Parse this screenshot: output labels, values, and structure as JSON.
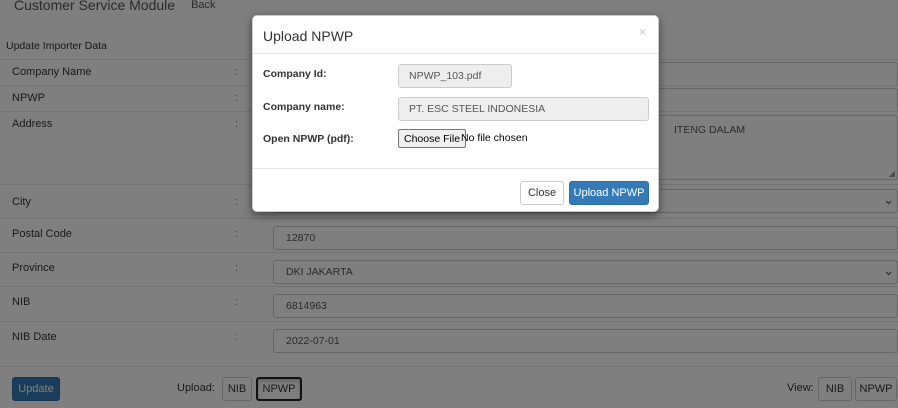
{
  "header": {
    "module_title": "Customer Service Module",
    "back_label": "Back"
  },
  "form": {
    "section_title": "Update Importer Data",
    "colon": ":",
    "rows": [
      {
        "label": "Company Name",
        "value": ""
      },
      {
        "label": "NPWP",
        "value": ""
      },
      {
        "label": "Address",
        "value": "ITENG DALAM"
      },
      {
        "label": "City",
        "value": ""
      },
      {
        "label": "Postal Code",
        "value": "12870"
      },
      {
        "label": "Province",
        "value": "DKI JAKARTA"
      },
      {
        "label": "NIB",
        "value": "6814963"
      },
      {
        "label": "NIB Date",
        "value": "2022-07-01"
      }
    ]
  },
  "footer": {
    "update_label": "Update",
    "upload_label": "Upload:",
    "upload_nib": "NIB",
    "upload_npwp": "NPWP",
    "view_label": "View:",
    "view_nib": "NIB",
    "view_npwp": "NPWP"
  },
  "modal": {
    "title": "Upload NPWP",
    "close_symbol": "×",
    "company_id_label": "Company Id:",
    "company_id_value": "NPWP_103.pdf",
    "company_name_label": "Company name:",
    "company_name_value": "PT. ESC STEEL INDONESIA",
    "open_label": "Open NPWP (pdf):",
    "choose_file_label": "Choose File",
    "file_status": "No file chosen",
    "close_button": "Close",
    "upload_button": "Upload NPWP"
  },
  "colors": {
    "primary": "#337ab7",
    "overlay": "rgba(0,0,0,0.5)"
  }
}
